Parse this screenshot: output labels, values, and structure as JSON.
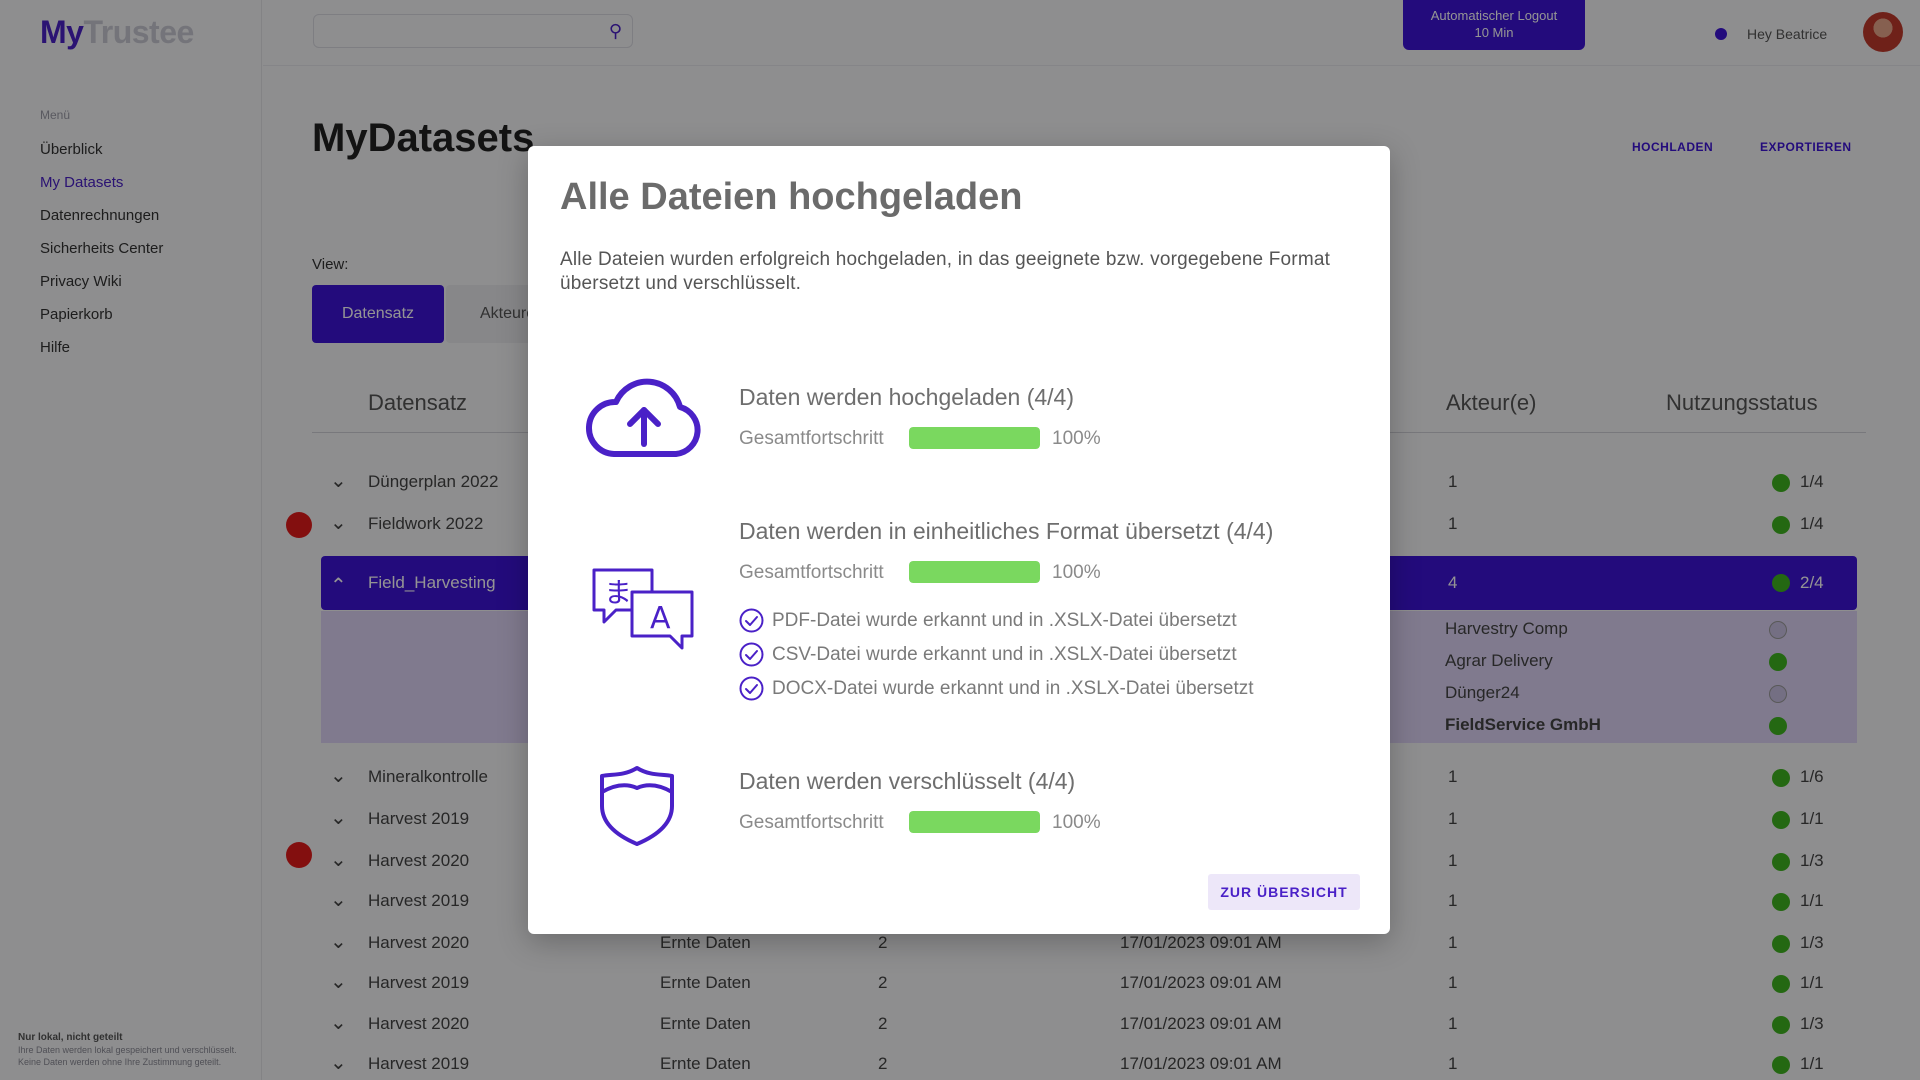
{
  "app": {
    "logo_primary": "My",
    "logo_secondary": "Trustee",
    "nav_section_label": "Menü",
    "nav_items": [
      "Überblick",
      "My Datasets",
      "Datenrechnungen",
      "Sicherheits Center",
      "Privacy Wiki",
      "Papierkorb",
      "Hilfe"
    ],
    "footer_title": "Nur lokal, nicht geteilt",
    "footer_text": "Ihre Daten werden lokal gespeichert und verschlüsselt. Keine Daten werden ohne Ihre Zustimmung geteilt.",
    "logout_line1": "Automatischer Logout",
    "logout_line2": "10 Min",
    "user_greeting": "Hey Beatrice",
    "page_title": "MyDatasets",
    "action_upload": "HOCHLADEN",
    "action_export": "EXPORTIEREN",
    "view_label": "View:",
    "view_tab_active": "Datensatz",
    "view_tab_other": "Akteure",
    "table_headers": {
      "dataset": "Datensatz",
      "actors": "Akteur(e)",
      "status": "Nutzungsstatus"
    },
    "rows": [
      {
        "name": "Düngerplan 2022",
        "type": "",
        "count": "",
        "date": "",
        "actors": "1",
        "status": "1/4"
      },
      {
        "name": "Fieldwork 2022",
        "type": "",
        "count": "",
        "date": "",
        "actors": "1",
        "status": "1/4"
      },
      {
        "name": "Field_Harvesting",
        "type": "",
        "count": "",
        "date": "",
        "actors": "4",
        "status": "2/4"
      },
      {
        "name": "Mineralkontrolle",
        "type": "",
        "count": "",
        "date": "",
        "actors": "1",
        "status": "1/6"
      },
      {
        "name": "Harvest 2019",
        "type": "",
        "count": "",
        "date": "",
        "actors": "1",
        "status": "1/1"
      },
      {
        "name": "Harvest 2020",
        "type": "",
        "count": "",
        "date": "",
        "actors": "1",
        "status": "1/3"
      },
      {
        "name": "Harvest 2019",
        "type": "",
        "count": "",
        "date": "",
        "actors": "1",
        "status": "1/1"
      },
      {
        "name": "Harvest 2020",
        "type": "Ernte Daten",
        "count": "2",
        "date": "17/01/2023 09:01 AM",
        "actors": "1",
        "status": "1/3"
      },
      {
        "name": "Harvest 2019",
        "type": "Ernte Daten",
        "count": "2",
        "date": "17/01/2023 09:01 AM",
        "actors": "1",
        "status": "1/1"
      },
      {
        "name": "Harvest 2020",
        "type": "Ernte Daten",
        "count": "2",
        "date": "17/01/2023 09:01 AM",
        "actors": "1",
        "status": "1/3"
      },
      {
        "name": "Harvest 2019",
        "type": "Ernte Daten",
        "count": "2",
        "date": "17/01/2023 09:01 AM",
        "actors": "1",
        "status": "1/1"
      }
    ],
    "sub_rows": [
      "Harvestry Comp",
      "Agrar Delivery",
      "Dünger24",
      "FieldService GmbH"
    ]
  },
  "modal": {
    "title": "Alle Dateien hochgeladen",
    "description": "Alle Dateien wurden erfolgreich hochgeladen, in das geeignete bzw. vorgegebene Format übersetzt und verschlüsselt.",
    "steps": [
      {
        "icon": "cloud-upload-icon",
        "title": "Daten werden hochgeladen (4/4)",
        "progress_label": "Gesamtfortschritt",
        "progress": 100,
        "progress_text": "100%"
      },
      {
        "icon": "translate-icon",
        "title": "Daten werden in einheitliches Format übersetzt (4/4)",
        "progress_label": "Gesamtfortschritt",
        "progress": 100,
        "progress_text": "100%",
        "checks": [
          "PDF-Datei wurde erkannt und in .XSLX-Datei übersetzt",
          "CSV-Datei wurde erkannt und in .XSLX-Datei übersetzt",
          "DOCX-Datei wurde erkannt und in .XSLX-Datei übersetzt"
        ]
      },
      {
        "icon": "shield-icon",
        "title": "Daten werden verschlüsselt (4/4)",
        "progress_label": "Gesamtfortschritt",
        "progress": 100,
        "progress_text": "100%"
      }
    ],
    "button_label": "ZUR ÜBERSICHT"
  },
  "colors": {
    "accent": "#4a21c7",
    "progress": "#7ad85f",
    "status_ok": "#3fb31f",
    "alert": "#e21b1b"
  }
}
